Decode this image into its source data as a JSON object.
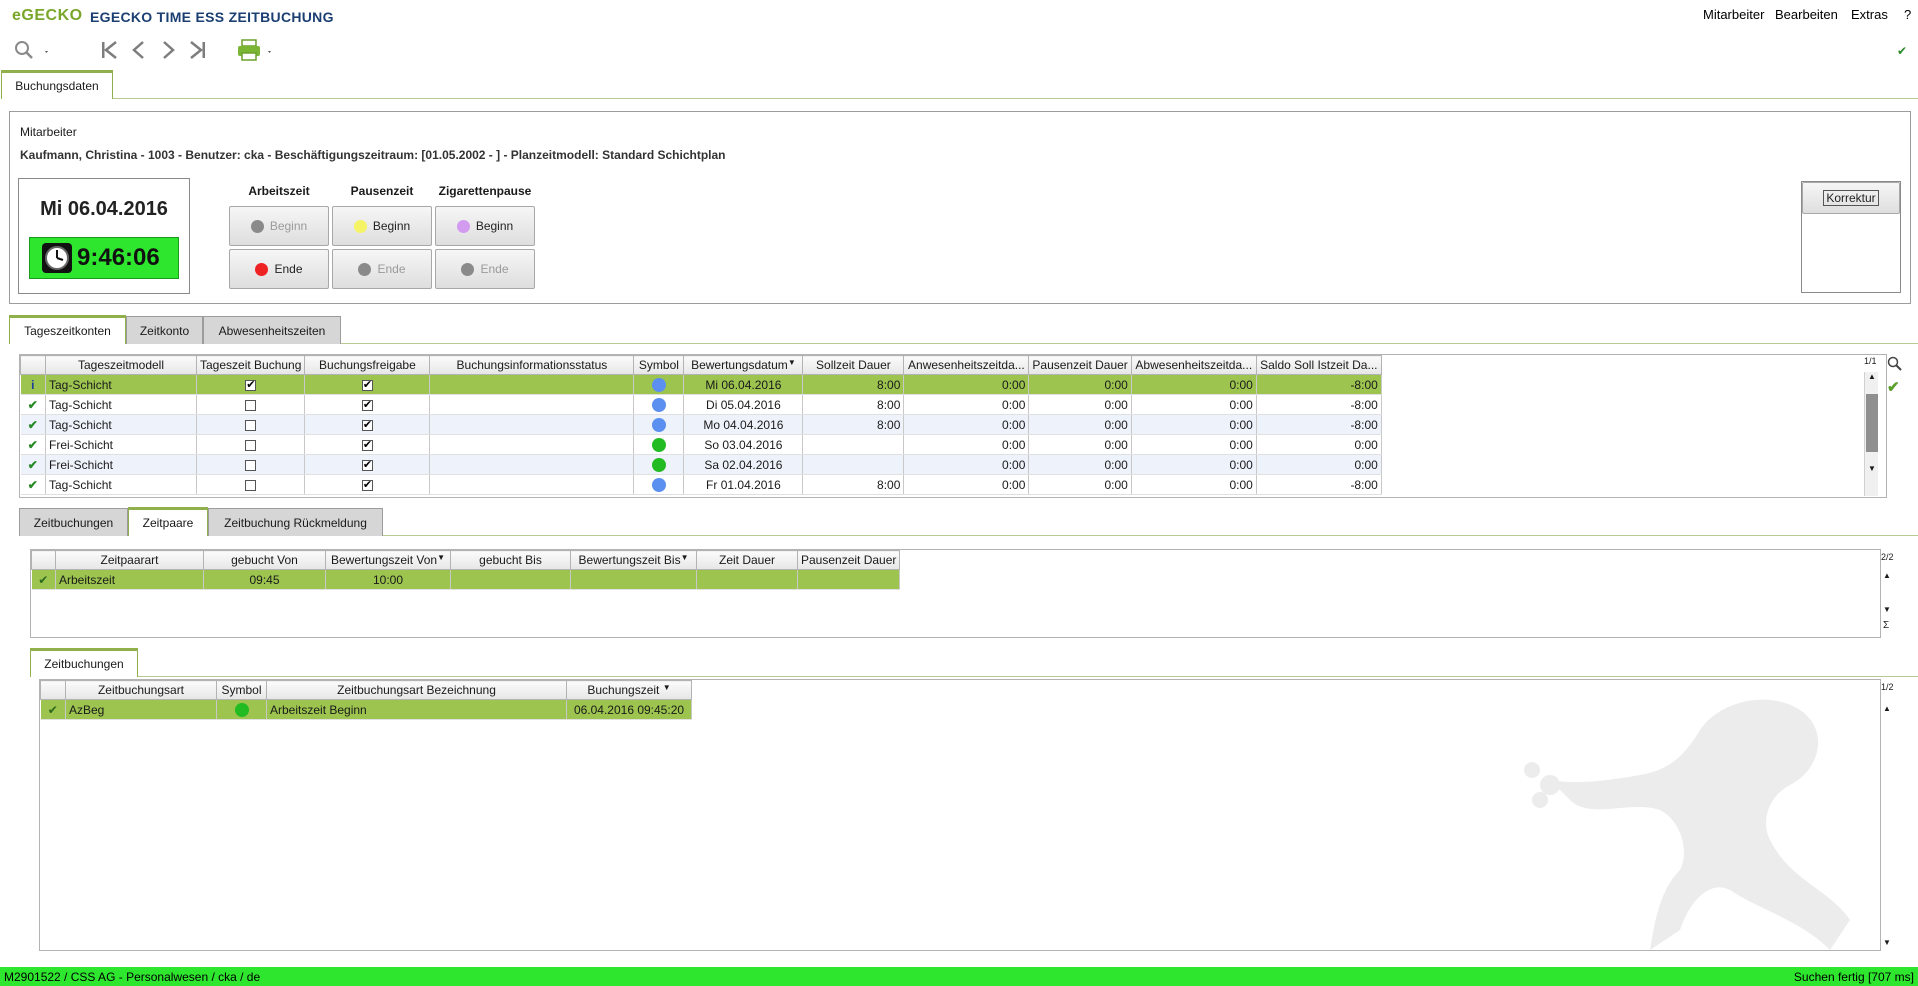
{
  "app": {
    "logo_e": "e",
    "logo_rest": "GECKO",
    "title": "EGECKO TIME ESS ZEITBUCHUNG"
  },
  "menu": {
    "items": [
      "Mitarbeiter",
      "Bearbeiten",
      "Extras",
      "?"
    ]
  },
  "toolbar": {
    "icons": [
      "search-icon",
      "first-icon",
      "prev-icon",
      "next-icon",
      "last-icon",
      "print-icon"
    ],
    "status_check": "✔"
  },
  "main_tab": {
    "label": "Buchungsdaten"
  },
  "employee": {
    "section_label": "Mitarbeiter",
    "info": "Kaufmann, Christina - 1003 - Benutzer: cka - Beschäftigungszeitraum: [01.05.2002 - ] - Planzeitmodell: Standard Schichtplan"
  },
  "clock": {
    "date": "Mi 06.04.2016",
    "time": "9:46:06"
  },
  "booking": {
    "headers": [
      "Arbeitszeit",
      "Pausenzeit",
      "Zigarettenpause"
    ],
    "begin": "Beginn",
    "end": "Ende",
    "colors": {
      "gray": "#8a8a8a",
      "yellow": "#f4f466",
      "violet": "#d39bf0",
      "red": "#ee2222"
    }
  },
  "korrektur": {
    "label": "Korrektur"
  },
  "tabs1": [
    "Tageszeitkonten",
    "Zeitkonto",
    "Abwesenheitszeiten"
  ],
  "table1": {
    "pager": "1/1",
    "columns": [
      "Tageszeitmodell",
      "Tageszeit Buchung",
      "Buchungsfreigabe",
      "Buchungsinformationsstatus",
      "Symbol",
      "Bewertungsdatum",
      "Sollzeit Dauer",
      "Anwesenheitszeitda...",
      "Pausenzeit Dauer",
      "Abwesenheitszeitda...",
      "Saldo Soll Istzeit Da..."
    ],
    "rows": [
      {
        "mark": "i",
        "model": "Tag-Schicht",
        "tz": true,
        "frei": true,
        "status": "",
        "symbol": "#5b8ff0",
        "date": "Mi 06.04.2016",
        "soll": "8:00",
        "anw": "0:00",
        "pause": "0:00",
        "abw": "0:00",
        "saldo": "-8:00"
      },
      {
        "mark": "✔",
        "model": "Tag-Schicht",
        "tz": false,
        "frei": true,
        "status": "",
        "symbol": "#5b8ff0",
        "date": "Di 05.04.2016",
        "soll": "8:00",
        "anw": "0:00",
        "pause": "0:00",
        "abw": "0:00",
        "saldo": "-8:00"
      },
      {
        "mark": "✔",
        "model": "Tag-Schicht",
        "tz": false,
        "frei": true,
        "status": "",
        "symbol": "#5b8ff0",
        "date": "Mo 04.04.2016",
        "soll": "8:00",
        "anw": "0:00",
        "pause": "0:00",
        "abw": "0:00",
        "saldo": "-8:00"
      },
      {
        "mark": "✔",
        "model": "Frei-Schicht",
        "tz": false,
        "frei": true,
        "status": "",
        "symbol": "#22bb22",
        "date": "So 03.04.2016",
        "soll": "",
        "anw": "0:00",
        "pause": "0:00",
        "abw": "0:00",
        "saldo": "0:00"
      },
      {
        "mark": "✔",
        "model": "Frei-Schicht",
        "tz": false,
        "frei": true,
        "status": "",
        "symbol": "#22bb22",
        "date": "Sa 02.04.2016",
        "soll": "",
        "anw": "0:00",
        "pause": "0:00",
        "abw": "0:00",
        "saldo": "0:00"
      },
      {
        "mark": "✔",
        "model": "Tag-Schicht",
        "tz": false,
        "frei": true,
        "status": "",
        "symbol": "#5b8ff0",
        "date": "Fr 01.04.2016",
        "soll": "8:00",
        "anw": "0:00",
        "pause": "0:00",
        "abw": "0:00",
        "saldo": "-8:00"
      }
    ]
  },
  "tabs2": [
    "Zeitbuchungen",
    "Zeitpaare",
    "Zeitbuchung Rückmeldung"
  ],
  "table2": {
    "pager": "2/2",
    "sigma": "Σ",
    "columns": [
      "Zeitpaarart",
      "gebucht Von",
      "Bewertungszeit Von",
      "gebucht Bis",
      "Bewertungszeit Bis",
      "Zeit Dauer",
      "Pausenzeit Dauer"
    ],
    "rows": [
      {
        "mark": "✔",
        "art": "Arbeitszeit",
        "von": "09:45",
        "bvon": "10:00",
        "bis": "",
        "bbis": "",
        "dauer": "",
        "pdauer": ""
      }
    ]
  },
  "tab3": {
    "label": "Zeitbuchungen"
  },
  "table3": {
    "pager": "1/2",
    "columns": [
      "Zeitbuchungsart",
      "Symbol",
      "Zeitbuchungsart Bezeichnung",
      "Buchungszeit"
    ],
    "rows": [
      {
        "mark": "✔",
        "art": "AzBeg",
        "symbol": "#22bb22",
        "bez": "Arbeitszeit Beginn",
        "zeit": "06.04.2016 09:45:20"
      }
    ]
  },
  "status": {
    "left": "M2901522 / CSS AG - Personalwesen / cka / de",
    "right": "Suchen fertig [707 ms]"
  }
}
